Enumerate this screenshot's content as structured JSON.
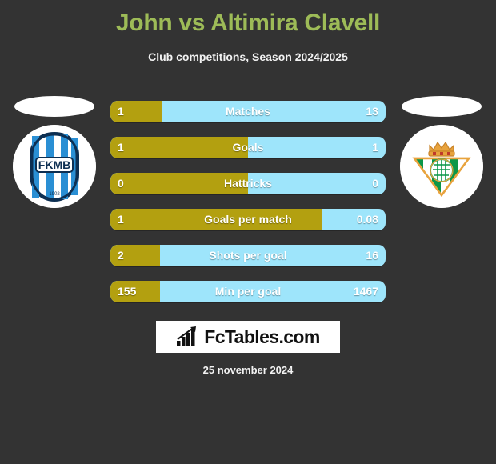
{
  "header": {
    "title": "John vs Altimira Clavell",
    "subtitle": "Club competitions, Season 2024/2025",
    "title_color": "#9dbb57"
  },
  "teams": {
    "home": {
      "badge_name": "fkmb-badge",
      "badge_text": "FKMB",
      "colors": [
        "#1f6fb5",
        "#ffffff",
        "#0d2f52"
      ]
    },
    "away": {
      "badge_name": "real-betis-badge",
      "colors": [
        "#00a650",
        "#ffffff",
        "#e8a33d"
      ]
    }
  },
  "chart_data": {
    "type": "bar",
    "title": "John vs Altimira Clavell",
    "subtitle": "Club competitions, Season 2024/2025",
    "categories": [
      "Matches",
      "Goals",
      "Hattricks",
      "Goals per match",
      "Shots per goal",
      "Min per goal"
    ],
    "series": [
      {
        "name": "John",
        "values": [
          "1",
          "1",
          "0",
          "1",
          "2",
          "155"
        ]
      },
      {
        "name": "Altimira Clavell",
        "values": [
          "13",
          "1",
          "0",
          "0.08",
          "16",
          "1467"
        ]
      }
    ],
    "home_fill_percent": [
      19,
      50,
      50,
      77,
      18,
      18
    ],
    "colors": {
      "home_bar": "#b3a010",
      "away_bar": "#9ee5fb",
      "background": "#333333"
    },
    "legend_position": "none",
    "grid": false
  },
  "rows": [
    {
      "label": "Matches",
      "home": "1",
      "away": "13",
      "fill": 19
    },
    {
      "label": "Goals",
      "home": "1",
      "away": "1",
      "fill": 50
    },
    {
      "label": "Hattricks",
      "home": "0",
      "away": "0",
      "fill": 50
    },
    {
      "label": "Goals per match",
      "home": "1",
      "away": "0.08",
      "fill": 77
    },
    {
      "label": "Shots per goal",
      "home": "2",
      "away": "16",
      "fill": 18
    },
    {
      "label": "Min per goal",
      "home": "155",
      "away": "1467",
      "fill": 18
    }
  ],
  "footer": {
    "logo_text": "FcTables.com",
    "logo_icon": "bar-chart-icon",
    "date": "25 november 2024"
  }
}
